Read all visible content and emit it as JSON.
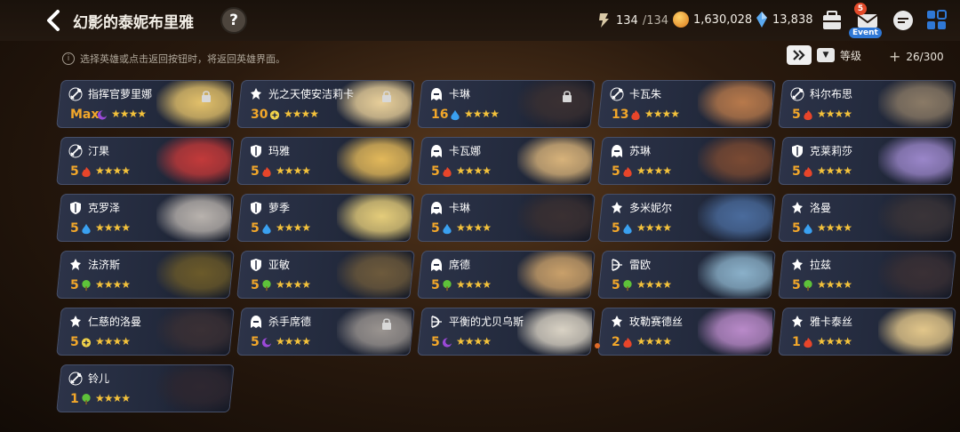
{
  "header": {
    "title": "幻影的泰妮布里雅",
    "help_label": "?",
    "stamina": "134",
    "stamina_max": "/134",
    "gold": "1,630,028",
    "crystals": "13,838",
    "mail_badge": "5",
    "event_label": "Event"
  },
  "toolbar": {
    "hint": "选择英雄或点击返回按钮时，将返回英雄界面。",
    "sort_label": "等级",
    "count": "26/300"
  },
  "colors": {
    "level_text": "#f2a72a",
    "star": "#f4c23b",
    "fire": "#e8452a",
    "water": "#3aa0f0",
    "wood": "#5ec23a",
    "dark": "#9b49d8",
    "light": "#f2d34a"
  },
  "heroes": [
    {
      "name": "指挥官萝里娜",
      "level": "Max",
      "element": "dark",
      "stars": "★★★★",
      "class": "sword-icon",
      "locked": true,
      "portrait": "#e2c06a"
    },
    {
      "name": "光之天使安洁莉卡",
      "level": "30",
      "element": "light",
      "stars": "★★★★",
      "class": "priest-icon",
      "locked": true,
      "portrait": "#e8cf9a"
    },
    {
      "name": "卡琳",
      "level": "16",
      "element": "water",
      "stars": "★★★★",
      "class": "assassin-icon",
      "locked": true,
      "portrait": "#3a3032"
    },
    {
      "name": "卡瓦朱",
      "level": "13",
      "element": "fire",
      "stars": "★★★★",
      "class": "sword-icon",
      "locked": false,
      "portrait": "#b7794b"
    },
    {
      "name": "科尔布思",
      "level": "5",
      "element": "fire",
      "stars": "★★★★",
      "class": "sword-icon",
      "locked": false,
      "portrait": "#8a7a66"
    },
    {
      "name": "汀果",
      "level": "5",
      "element": "fire",
      "stars": "★★★★",
      "class": "sword-icon",
      "locked": false,
      "portrait": "#c23a3a"
    },
    {
      "name": "玛雅",
      "level": "5",
      "element": "fire",
      "stars": "★★★★",
      "class": "shield-icon",
      "locked": false,
      "portrait": "#e2b85a"
    },
    {
      "name": "卡瓦娜",
      "level": "5",
      "element": "fire",
      "stars": "★★★★",
      "class": "assassin-icon",
      "locked": false,
      "portrait": "#d7b27a"
    },
    {
      "name": "苏琳",
      "level": "5",
      "element": "fire",
      "stars": "★★★★",
      "class": "assassin-icon",
      "locked": false,
      "portrait": "#7a4a33"
    },
    {
      "name": "克莱莉莎",
      "level": "5",
      "element": "fire",
      "stars": "★★★★",
      "class": "shield-icon",
      "locked": false,
      "portrait": "#9a86c9"
    },
    {
      "name": "克罗泽",
      "level": "5",
      "element": "water",
      "stars": "★★★★",
      "class": "shield-icon",
      "locked": false,
      "portrait": "#b8b2ad"
    },
    {
      "name": "萝季",
      "level": "5",
      "element": "water",
      "stars": "★★★★",
      "class": "shield-icon",
      "locked": false,
      "portrait": "#e4cc7a"
    },
    {
      "name": "卡琳",
      "level": "5",
      "element": "water",
      "stars": "★★★★",
      "class": "assassin-icon",
      "locked": false,
      "portrait": "#3a3032"
    },
    {
      "name": "多米妮尔",
      "level": "5",
      "element": "water",
      "stars": "★★★★",
      "class": "priest-icon",
      "locked": false,
      "portrait": "#4a6b9c"
    },
    {
      "name": "洛曼",
      "level": "5",
      "element": "water",
      "stars": "★★★★",
      "class": "priest-icon",
      "locked": false,
      "portrait": "#3a3438"
    },
    {
      "name": "法济斯",
      "level": "5",
      "element": "wood",
      "stars": "★★★★",
      "class": "priest-icon",
      "locked": false,
      "portrait": "#6b5a2a"
    },
    {
      "name": "亚敏",
      "level": "5",
      "element": "wood",
      "stars": "★★★★",
      "class": "shield-icon",
      "locked": false,
      "portrait": "#6d5a3c"
    },
    {
      "name": "席德",
      "level": "5",
      "element": "wood",
      "stars": "★★★★",
      "class": "assassin-icon",
      "locked": false,
      "portrait": "#c9a06a"
    },
    {
      "name": "雷欧",
      "level": "5",
      "element": "wood",
      "stars": "★★★★",
      "class": "bow-icon",
      "locked": false,
      "portrait": "#8ab0c9"
    },
    {
      "name": "拉兹",
      "level": "5",
      "element": "wood",
      "stars": "★★★★",
      "class": "priest-icon",
      "locked": false,
      "portrait": "#3a3035"
    },
    {
      "name": "仁慈的洛曼",
      "level": "5",
      "element": "light",
      "stars": "★★★★",
      "class": "priest-icon",
      "locked": false,
      "portrait": "#3a3035"
    },
    {
      "name": "杀手席德",
      "level": "5",
      "element": "dark",
      "stars": "★★★★",
      "class": "assassin-icon",
      "locked": true,
      "portrait": "#9a9490"
    },
    {
      "name": "平衡的尤贝乌斯",
      "level": "5",
      "element": "dark",
      "stars": "★★★★",
      "class": "bow-icon",
      "locked": false,
      "portrait": "#d9d2c4"
    },
    {
      "name": "玫勒赛德丝",
      "level": "2",
      "element": "fire",
      "stars": "★★★★",
      "class": "priest-icon",
      "locked": false,
      "portrait": "#b98ac9"
    },
    {
      "name": "雅卡泰丝",
      "level": "1",
      "element": "fire",
      "stars": "★★★★",
      "class": "priest-icon",
      "locked": false,
      "portrait": "#e2c68a"
    },
    {
      "name": "铃儿",
      "level": "1",
      "element": "wood",
      "stars": "★★★★",
      "class": "sword-icon",
      "locked": false,
      "portrait": "#2e2730"
    }
  ]
}
